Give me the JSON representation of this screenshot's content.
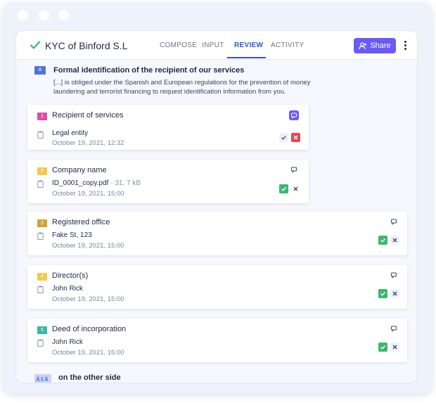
{
  "app": {
    "title": "KYC of Binford S.L"
  },
  "tabs": [
    {
      "label": "COMPOSE"
    },
    {
      "label": "INPUT"
    },
    {
      "label": "REVIEW"
    },
    {
      "label": "ACTIVITY"
    }
  ],
  "share_label": "Share",
  "section": {
    "badge": "A",
    "title": "Formal identification of the recipient of our services",
    "description": "[...] is obliged under the Spanish and European regulations for the prevention of money laundering and terrorist financing to request identification information from you."
  },
  "cards": [
    {
      "number": "1",
      "title": "Recipient of services",
      "value": "Legal entity",
      "size": "",
      "date": "October 19, 2021, 12:32",
      "accepted": false,
      "rejected": true
    },
    {
      "number": "2",
      "title": "Company name",
      "value": "ID_0001_copy.pdf",
      "size": "31, 7 kB",
      "date": "October 19, 2021, 15:00",
      "accepted": true,
      "rejected": false
    },
    {
      "number": "3",
      "title": "Registered office",
      "value": "Fake St, 123",
      "size": "",
      "date": "October 19, 2021, 15:00",
      "accepted": true,
      "rejected": false
    },
    {
      "number": "4",
      "title": "Director(s)",
      "value": "John Rick",
      "size": "",
      "date": "October 19, 2021, 15:00",
      "accepted": true,
      "rejected": false
    },
    {
      "number": "5",
      "title": "Deed of incorporation",
      "value": "John Rick",
      "size": "",
      "date": "October 19, 2021, 15:00",
      "accepted": true,
      "rejected": false
    }
  ],
  "colors": {
    "accent": "#6a5af9",
    "tab_active": "#2f53c9",
    "accept": "#3bb86d",
    "reject": "#e2474a",
    "num1": "#e04ea0",
    "num2": "#f2c94c",
    "num3": "#d4a03a",
    "num4": "#f2c94c",
    "num5": "#35b8a8"
  },
  "bottom": {
    "text": "on the other side"
  }
}
